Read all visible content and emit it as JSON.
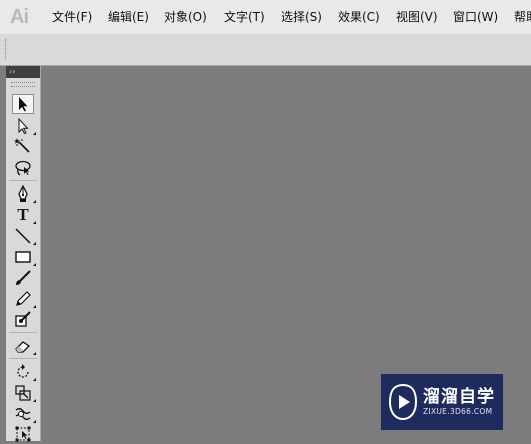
{
  "app": {
    "logo": "Ai"
  },
  "menubar": {
    "items": [
      {
        "label": "文件(F)"
      },
      {
        "label": "编辑(E)"
      },
      {
        "label": "对象(O)"
      },
      {
        "label": "文字(T)"
      },
      {
        "label": "选择(S)"
      },
      {
        "label": "效果(C)"
      },
      {
        "label": "视图(V)"
      },
      {
        "label": "窗口(W)"
      },
      {
        "label": "帮助"
      }
    ]
  },
  "toolbox": {
    "collapse_glyph": "››",
    "tools": [
      {
        "name": "selection-tool",
        "icon": "selection-arrow-icon",
        "selected": true
      },
      {
        "name": "direct-selection-tool",
        "icon": "direct-selection-arrow-icon"
      },
      {
        "name": "magic-wand-tool",
        "icon": "magic-wand-icon"
      },
      {
        "name": "lasso-tool",
        "icon": "lasso-icon"
      },
      {
        "name": "pen-tool",
        "icon": "pen-icon"
      },
      {
        "name": "type-tool",
        "icon": "type-icon",
        "glyph": "T"
      },
      {
        "name": "line-segment-tool",
        "icon": "line-icon"
      },
      {
        "name": "rectangle-tool",
        "icon": "rectangle-icon"
      },
      {
        "name": "paintbrush-tool",
        "icon": "paintbrush-icon"
      },
      {
        "name": "pencil-tool",
        "icon": "pencil-icon"
      },
      {
        "name": "blob-brush-tool",
        "icon": "blob-brush-icon"
      },
      {
        "name": "eraser-tool",
        "icon": "eraser-icon"
      },
      {
        "name": "rotate-tool",
        "icon": "rotate-icon"
      },
      {
        "name": "scale-tool",
        "icon": "scale-icon"
      },
      {
        "name": "warp-tool",
        "icon": "warp-icon"
      },
      {
        "name": "free-transform-tool",
        "icon": "free-transform-icon"
      }
    ]
  },
  "canvas": {
    "background": "#7c7b7e"
  },
  "watermark": {
    "title": "溜溜自学",
    "url": "ZIXUE.3D66.COM",
    "background": "#1f2b5c"
  }
}
